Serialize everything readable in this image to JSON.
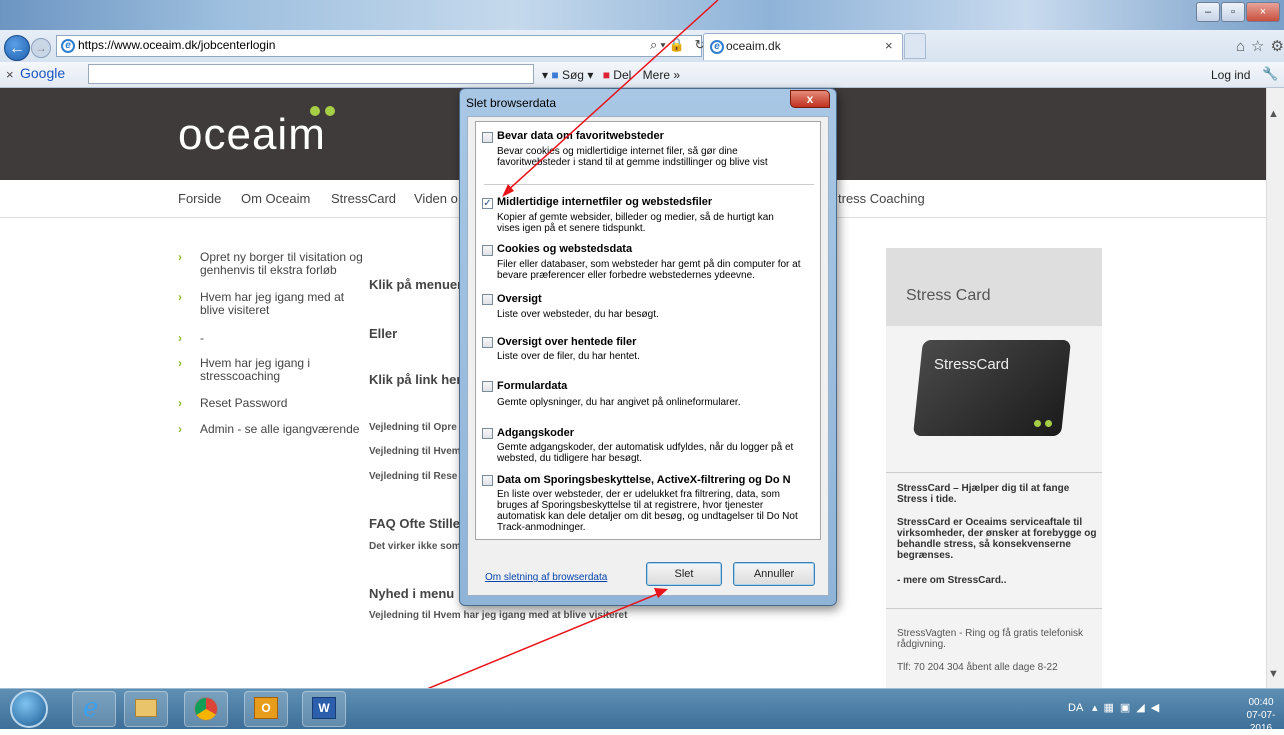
{
  "browser": {
    "url": "https://www.oceaim.dk/jobcenterlogin",
    "tab_title": "oceaim.dk",
    "tab_close": "×",
    "google_label": "Google",
    "search_label": "Søg",
    "share_label": "Del",
    "more_label": "Mere »",
    "login_label": "Log ind"
  },
  "site": {
    "logo_text": "oceaim",
    "nav": [
      "Forside",
      "Om Oceaim",
      "StressCard",
      "Viden o",
      "tress Coaching"
    ],
    "sidebar_links": [
      "Opret ny borger til visitation og genhenvis til ekstra forløb",
      "Hvem har jeg igang med at blive visiteret",
      "-",
      "Hvem har jeg igang i stresscoaching",
      "Reset Password",
      "Admin - se alle igangværende"
    ],
    "main": {
      "heading1": "Klik på menuen",
      "heading2": "Eller",
      "heading3": "Klik på link her",
      "guide1": "Vejledning til Opre",
      "guide2": "Vejledning til Hvem",
      "guide3": "Vejledning til Rese",
      "faq": "FAQ Ofte Stille",
      "faq_sub": "Det virker ikke som",
      "news": "Nyhed i menu",
      "news_sub": "Vejledning til Hvem har jeg igang med at blive visiteret"
    },
    "card": {
      "title": "Stress Card",
      "image_label": "StressCard",
      "p1": "StressCard – Hjælper dig til at fange Stress i tide.",
      "p2": "StressCard er Oceaims serviceaftale til virksomheder, der ønsker at forebygge og behandle stress, så konsekvenserne begrænses.",
      "more": "- mere om StressCard..",
      "vagten": "StressVagten - Ring og få gratis telefonisk rådgivning.",
      "phone": "Tlf: 70 204 304 åbent alle dage 8-22"
    }
  },
  "dialog": {
    "title": "Slet browserdata",
    "close": "x",
    "options": [
      {
        "title": "Bevar data om favoritwebsteder",
        "desc": "Bevar cookies og midlertidige internet filer, så gør dine favoritwebsteder i stand til at gemme indstillinger og blive vist",
        "checked": false
      },
      {
        "title": "Midlertidige internetfiler og webstedsfiler",
        "desc": "Kopier af gemte websider, billeder og medier, så de hurtigt kan vises igen på et senere tidspunkt.",
        "checked": true
      },
      {
        "title": "Cookies og webstedsdata",
        "desc": "Filer eller databaser, som websteder har gemt på din computer for at bevare præferencer eller forbedre webstedernes ydeevne.",
        "checked": false
      },
      {
        "title": "Oversigt",
        "desc": "Liste over websteder, du har besøgt.",
        "checked": false
      },
      {
        "title": "Oversigt over hentede filer",
        "desc": "Liste over de filer, du har hentet.",
        "checked": false
      },
      {
        "title": "Formulardata",
        "desc": "Gemte oplysninger, du har angivet på onlineformularer.",
        "checked": false
      },
      {
        "title": "Adgangskoder",
        "desc": "Gemte adgangskoder, der automatisk udfyldes, når du logger på et websted, du tidligere har besøgt.",
        "checked": false
      },
      {
        "title": "Data om Sporingsbeskyttelse, ActiveX-filtrering og Do N",
        "desc": "En liste over websteder, der er udelukket fra filtrering, data, som bruges af Sporingsbeskyttelse til at registrere, hvor tjenester automatisk kan dele detaljer om dit besøg, og undtagelser til Do Not Track-anmodninger.",
        "checked": false
      }
    ],
    "link": "Om sletning af browserdata",
    "delete_label": "Slet",
    "cancel_label": "Annuller"
  },
  "taskbar": {
    "lang": "DA",
    "time": "00:40",
    "date": "07-07-2016"
  },
  "colors": {
    "site_header": "#3f3b3b",
    "logo_dots": "#a6cf45",
    "annotation_arrow": "#e8141b"
  }
}
